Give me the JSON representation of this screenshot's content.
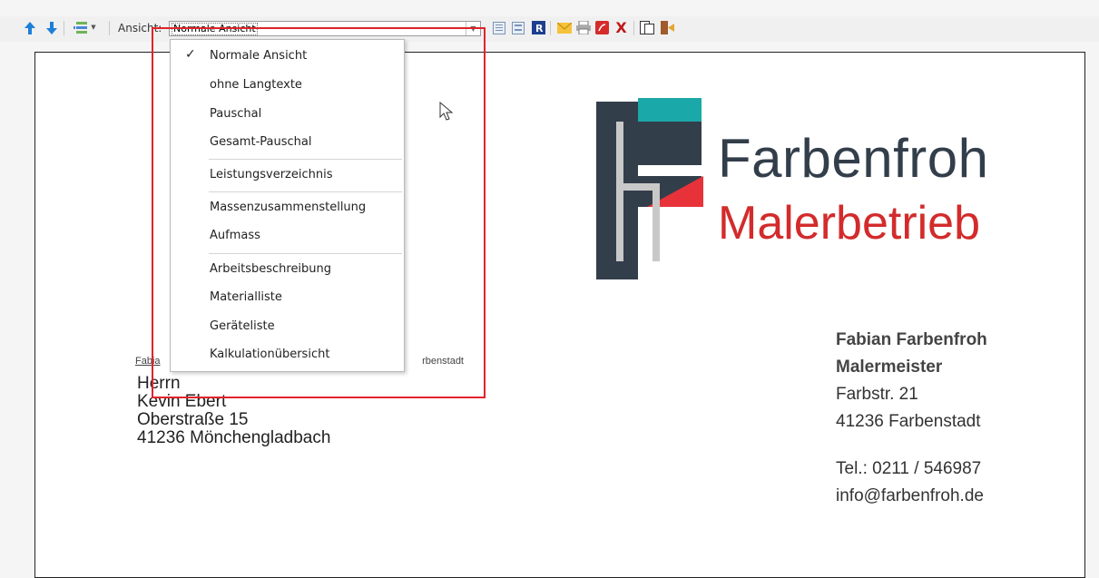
{
  "toolbar": {
    "ansicht_label": "Ansicht:",
    "selected_view": "Normale Ansicht",
    "icons": [
      "arrow-up-icon",
      "arrow-down-icon",
      "insert-row-icon",
      "page-view-icon",
      "page-view-alt-icon",
      "r-icon",
      "email-icon",
      "print-icon",
      "pdf-icon",
      "close-x-icon",
      "copy-pages-icon",
      "exit-icon"
    ]
  },
  "dropdown": {
    "items": [
      {
        "label": "Normale Ansicht",
        "checked": true
      },
      {
        "label": "ohne Langtexte"
      },
      {
        "label": "Pauschal"
      },
      {
        "label": "Gesamt-Pauschal"
      },
      {
        "label": "Leistungsverzeichnis"
      },
      {
        "label": "Massenzusammenstellung"
      },
      {
        "label": "Aufmass"
      },
      {
        "label": "Arbeitsbeschreibung"
      },
      {
        "label": "Materialliste"
      },
      {
        "label": "Geräteliste"
      },
      {
        "label": "Kalkulationübersicht"
      }
    ],
    "check_mark": "✓"
  },
  "logo": {
    "line1": "Farbenfroh",
    "line2": "Malerbetrieb"
  },
  "sender": {
    "name": "Fabian Farbenfroh",
    "title": "Malermeister",
    "street": "Farbstr. 21",
    "city": "41236 Farbenstadt",
    "phone": "Tel.: 0211 / 546987",
    "email": "info@farbenfroh.de"
  },
  "sender_line": {
    "left": "Fabia",
    "right": "rbenstadt"
  },
  "recipient": {
    "salutation": "Herrn",
    "name": "Kevin Ebert",
    "street": "Oberstraße 15",
    "city": "41236  Mönchengladbach"
  },
  "colors": {
    "highlight": "#e0242a",
    "logo_dark": "#333e4b",
    "logo_red": "#d32b2b",
    "logo_teal": "#1aa8a8"
  }
}
